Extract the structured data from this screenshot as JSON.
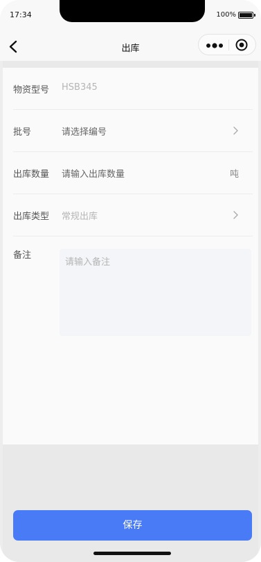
{
  "status_bar": {
    "time": "17:34",
    "battery": "100%"
  },
  "nav": {
    "title": "出库"
  },
  "form": {
    "material_model": {
      "label": "物资型号",
      "value": "HSB345"
    },
    "batch": {
      "label": "批号",
      "placeholder": "请选择编号"
    },
    "quantity": {
      "label": "出库数量",
      "placeholder": "请输入出库数量",
      "unit": "吨"
    },
    "outbound_type": {
      "label": "出库类型",
      "value": "常规出库"
    },
    "remarks": {
      "label": "备注",
      "placeholder": "请输入备注"
    }
  },
  "actions": {
    "save_label": "保存"
  },
  "colors": {
    "primary": "#4a7bf7",
    "page_bg": "#fafafa"
  },
  "icons": [
    "back-arrow-icon",
    "more-dots-icon",
    "close-target-icon",
    "chevron-right-icon"
  ]
}
